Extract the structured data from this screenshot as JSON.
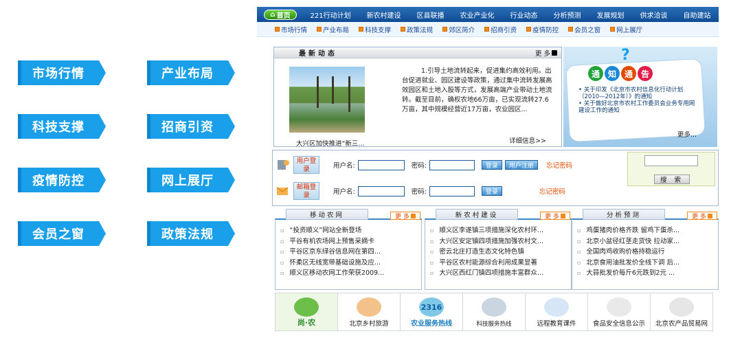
{
  "tiles": [
    "市场行情",
    "产业布局",
    "科技支撑",
    "招商引资",
    "疫情防控",
    "网上展厅",
    "会员之窗",
    "政策法规"
  ],
  "topnav": {
    "home": "首页",
    "items": [
      "221行动计划",
      "新农村建设",
      "区县联播",
      "农业产业化",
      "行业动态",
      "分析预测",
      "发展规划",
      "供求洽谈",
      "自助建站"
    ]
  },
  "subnav": [
    "市场行情",
    "产业布局",
    "科技支撑",
    "政策法规",
    "郊区简介",
    "招商引资",
    "疫情防控",
    "会员之窗",
    "网上展厅"
  ],
  "news": {
    "title": "最新动态",
    "more": "更 多",
    "caption": "大兴区加快推进“新三...",
    "body": "1.引导土地流转起来，促进集约高效利用。出台促进就业、园区建设等政策，通过集中流转发展高效园区和土地入股等方式，发展高端产业带动土地流转。截至目前，确权农地66万亩，已实现流转27.6万亩，其中规模经营近17万亩，农业园区...",
    "detail": "详细信息>>"
  },
  "notice": {
    "chars": [
      "通",
      "知",
      "通",
      "告"
    ],
    "items": [
      "• 关于印发《北京市农村信息化行动计划（2010—2012年）》的通知",
      "• 关于做好北京市农村工作委员会业务专用网建设工作的通知"
    ],
    "more": "更多..."
  },
  "login": {
    "user_label": "用户登录",
    "mail_label": "邮箱登录",
    "username": "用户名:",
    "password": "密码:",
    "login_btn": "登录",
    "reg_btn": "用户注册",
    "forgot": "忘记密码",
    "search_btn": "搜 索"
  },
  "columns": [
    {
      "title": "移动农网",
      "more": "更 多",
      "items": [
        "“投资顺义”网站全新登场",
        "平谷有机农场网上预售采摘卡",
        "平谷区京东绿谷信息网在第四...",
        "怀柔区无线宽带基础设施及应...",
        "顺义区移动农网工作荣获2009..."
      ]
    },
    {
      "title": "新农村建设",
      "more": "更 多",
      "items": [
        "顺义区李遂镇三项措施深化农村环...",
        "大兴区安定镇四项措施加强农村文...",
        "密云北庄打造生态文化特色镇",
        "平谷区农村能源综合利用成果显著",
        "大兴区西红门镇四项措施丰富群众..."
      ]
    },
    {
      "title": "分析预测",
      "more": "更 多",
      "items": [
        "鸡蛋猪肉价格齐跌 留鸡下蛋杀...",
        "北京小盆径红茎走货快 拉动家...",
        "全国肉鸡收购价格持稳运行",
        "北京食用油批发价全线下调 后...",
        "大蒜批发价每斤6元跌到2元 ..."
      ]
    }
  ],
  "links": [
    "尚·农",
    "北京乡村旅游",
    "农业服务热线",
    "科技服务热线",
    "远程教育课件",
    "食品安全信息公示",
    "北京农产品贸易网"
  ],
  "links_logos": [
    "",
    "",
    "",
    "2316",
    "",
    "",
    ""
  ]
}
